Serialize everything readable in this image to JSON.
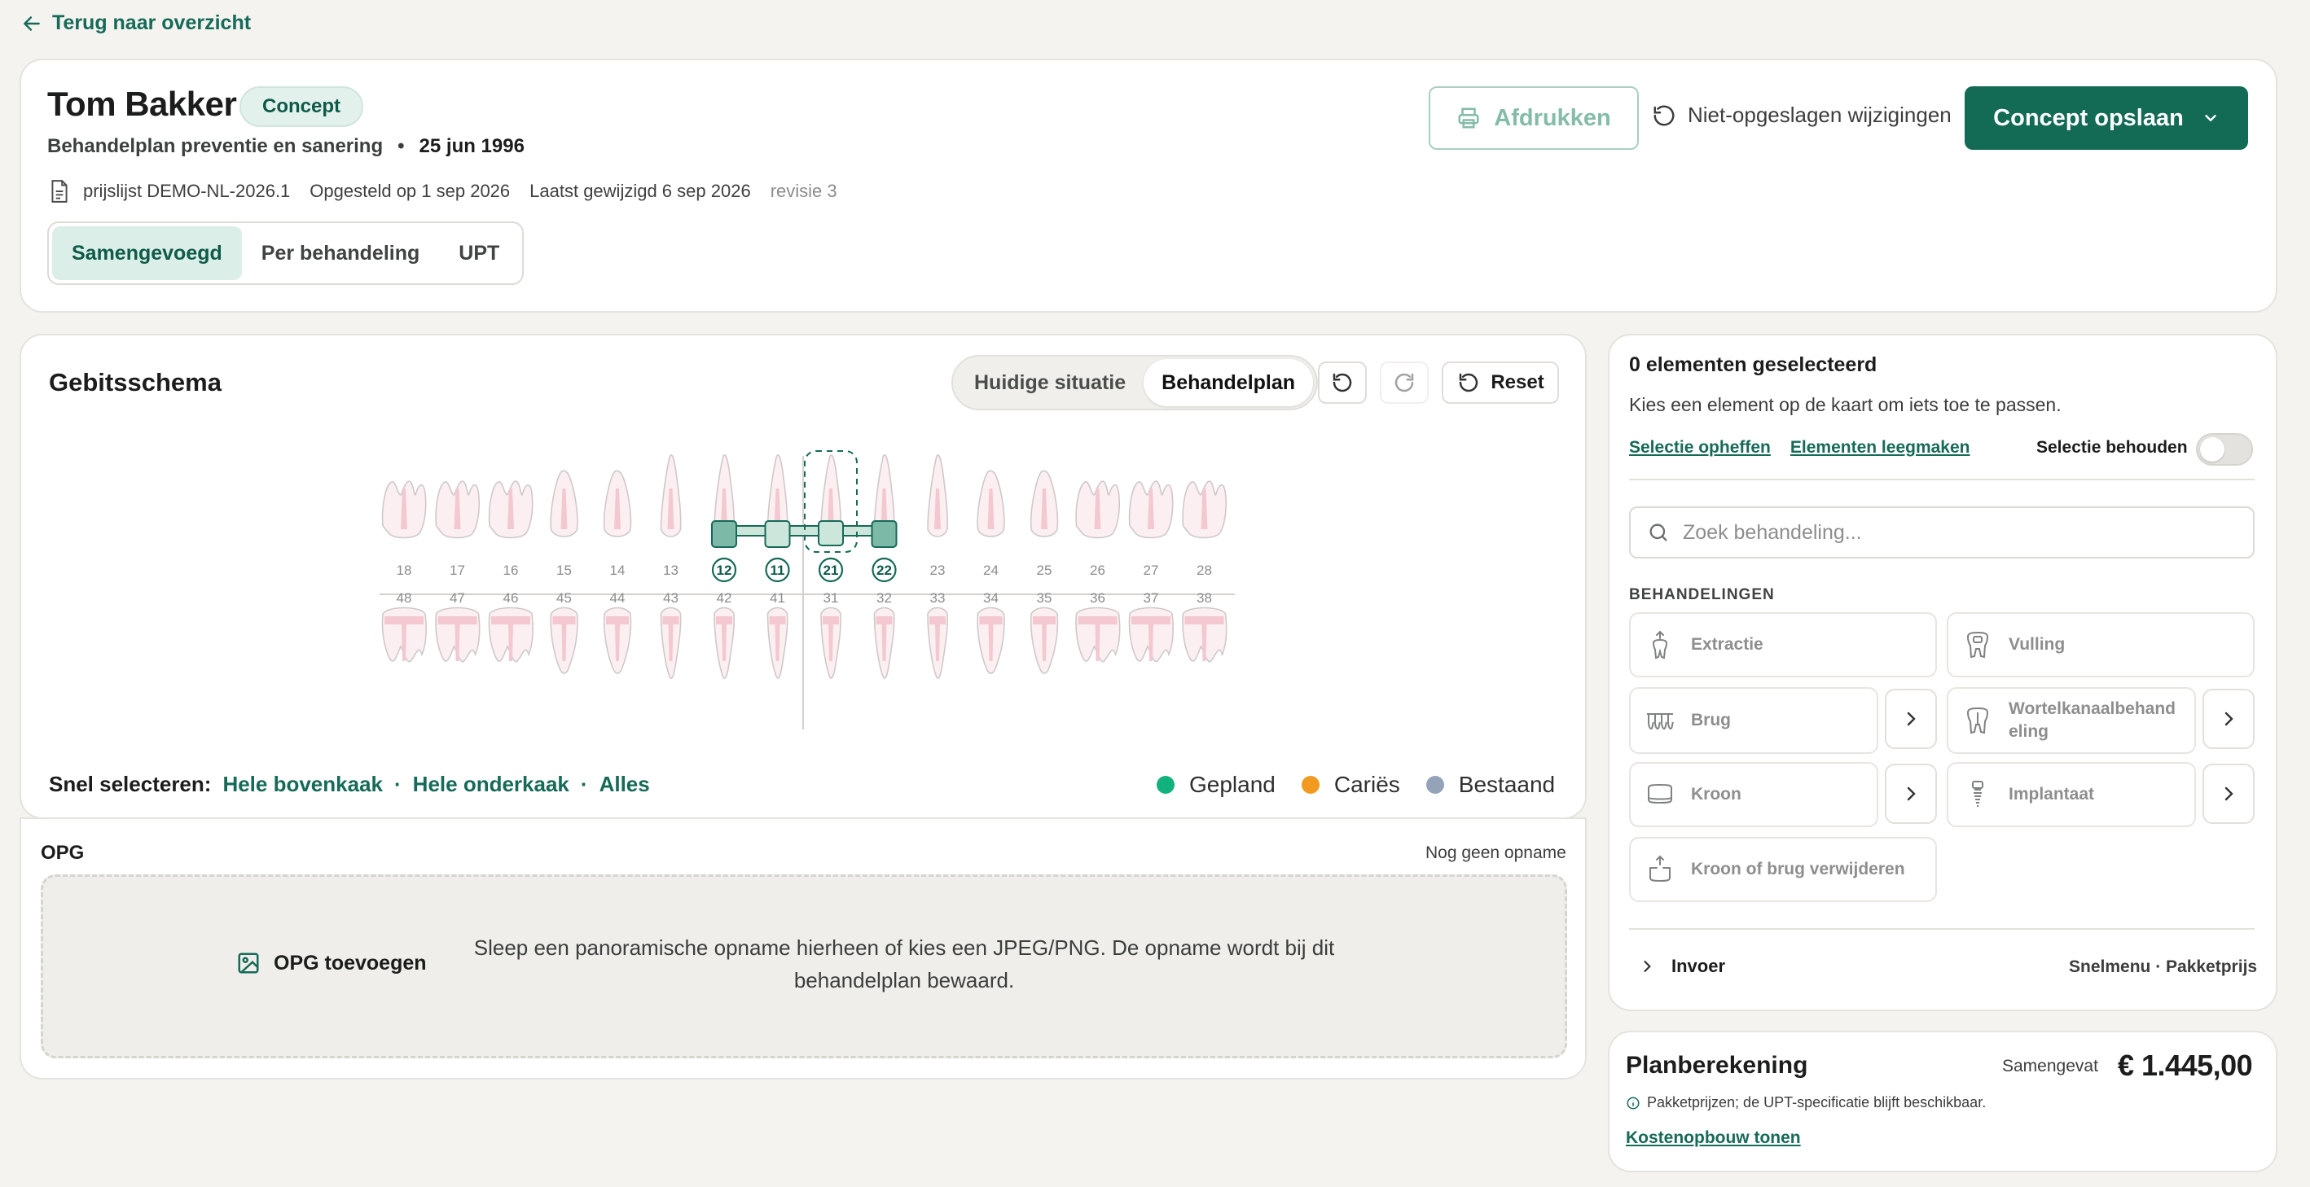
{
  "nav": {
    "back_label": "Terug naar overzicht"
  },
  "header": {
    "patient_name": "Tom Bakker",
    "status_badge": "Concept",
    "plan_name": "Behandelplan preventie en sanering",
    "separator": "•",
    "dob": "25 jun 1996",
    "pricelist": "prijslijst DEMO-NL-2026.1",
    "created": "Opgesteld op 1 sep 2026",
    "modified": "Laatst gewijzigd 6 sep 2026",
    "revision": "revisie 3",
    "views": [
      "Samengevoegd",
      "Per behandeling",
      "UPT"
    ],
    "active_view": "Samengevoegd",
    "print_label": "Afdrukken",
    "unsaved_label": "Niet-opgeslagen wijzigingen",
    "save_label": "Concept opslaan"
  },
  "chart": {
    "title": "Gebitsschema",
    "modes": [
      "Huidige situatie",
      "Behandelplan"
    ],
    "active_mode": "Behandelplan",
    "reset_label": "Reset",
    "upper_teeth": [
      "18",
      "17",
      "16",
      "15",
      "14",
      "13",
      "12",
      "11",
      "21",
      "22",
      "23",
      "24",
      "25",
      "26",
      "27",
      "28"
    ],
    "lower_teeth": [
      "48",
      "47",
      "46",
      "45",
      "44",
      "43",
      "42",
      "41",
      "31",
      "32",
      "33",
      "34",
      "35",
      "36",
      "37",
      "38"
    ],
    "bridge_teeth": [
      "12",
      "11",
      "21",
      "22"
    ],
    "pontic_tooth": "21",
    "quick_select_label": "Snel selecteren:",
    "quick_select": [
      "Hele bovenkaak",
      "Hele onderkaak",
      "Alles"
    ],
    "quick_sep": "·",
    "legend": [
      {
        "label": "Gepland",
        "color": "#12b27f"
      },
      {
        "label": "Cariës",
        "color": "#f29a1f"
      },
      {
        "label": "Bestaand",
        "color": "#94a3b8"
      }
    ]
  },
  "opg": {
    "title": "OPG",
    "status": "Nog geen opname",
    "add_label": "OPG toevoegen",
    "drop_text": "Sleep een panoramische opname hierheen of kies een JPEG/PNG. De opname wordt bij dit behandelplan bewaard."
  },
  "selection": {
    "title": "0 elementen geselecteerd",
    "subtitle": "Kies een element op de kaart om iets toe te passen.",
    "clear_label": "Selectie opheffen",
    "empty_label": "Elementen leegmaken",
    "keep_label": "Selectie behouden",
    "keep_on": false,
    "search_placeholder": "Zoek behandeling...",
    "treatments_heading": "BEHANDELINGEN",
    "treatments": [
      {
        "label": "Extractie",
        "icon": "extraction-icon",
        "has_more": false
      },
      {
        "label": "Vulling",
        "icon": "filling-icon",
        "has_more": false
      },
      {
        "label": "Brug",
        "icon": "bridge-icon",
        "has_more": true
      },
      {
        "label": "Wortelkanaalbehandeling",
        "icon": "root-canal-icon",
        "has_more": true
      },
      {
        "label": "Kroon",
        "icon": "crown-icon",
        "has_more": true
      },
      {
        "label": "Implantaat",
        "icon": "implant-icon",
        "has_more": true
      },
      {
        "label": "Kroon of brug verwijderen",
        "icon": "remove-crown-icon",
        "has_more": false
      }
    ],
    "input_label": "Invoer",
    "input_hint": "Snelmenu · Pakketprijs"
  },
  "plan": {
    "title": "Planberekening",
    "mode": "Samengevat",
    "total": "€ 1.445,00",
    "note": "Pakketprijzen; de UPT-specificatie blijft beschikbaar.",
    "breakdown_link": "Kostenopbouw tonen"
  }
}
